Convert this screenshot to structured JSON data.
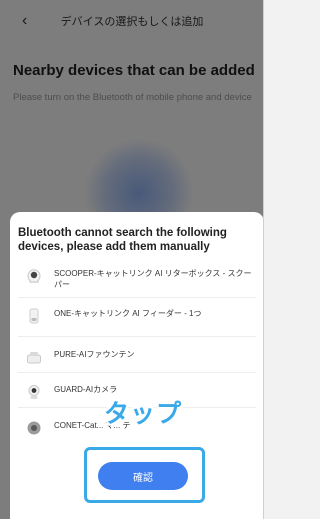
{
  "nav": {
    "back_glyph": "‹",
    "title": "デバイスの選択もしくは追加"
  },
  "main": {
    "heading": "Nearby devices that can be added",
    "subtext": "Please turn on the Bluetooth of mobile phone and device"
  },
  "sheet": {
    "title": "Bluetooth cannot search the following devices, please add them manually",
    "devices": [
      {
        "name": "SCOOPER-キャットリンク AI リターボックス - スクーパー",
        "icon": "litter-box-icon"
      },
      {
        "name": "ONE-キャットリンク AI フィーダー - 1つ",
        "icon": "feeder-icon"
      },
      {
        "name": "PURE-AIファウンテン",
        "icon": "fountain-icon"
      },
      {
        "name": "GUARD-AIカメラ",
        "icon": "camera-icon"
      },
      {
        "name": "CONET-Cat... マ... テ",
        "icon": "collar-icon"
      }
    ],
    "confirm_label": "確認"
  },
  "annotation": {
    "tap_text": "タップ",
    "highlight_color": "#3aa9e8"
  },
  "colors": {
    "accent": "#3f7ff0"
  }
}
